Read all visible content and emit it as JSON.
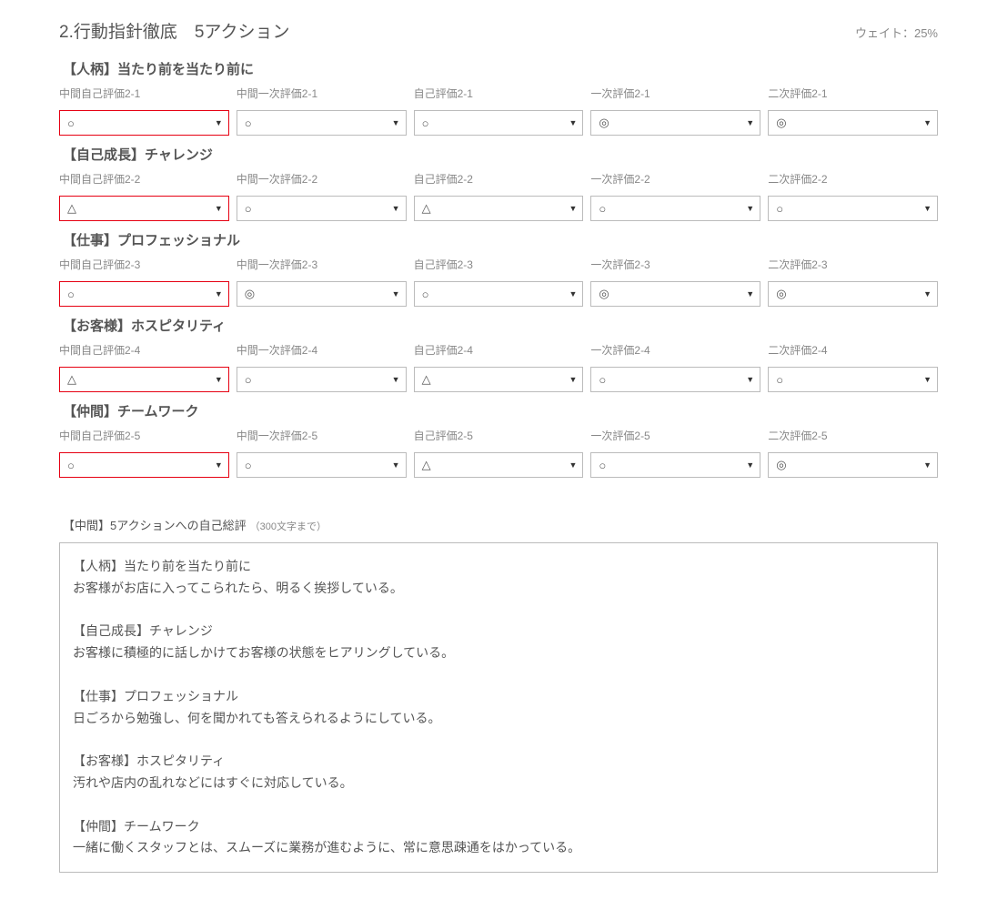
{
  "header": {
    "title": "2.行動指針徹底　5アクション",
    "weight": "ウェイト：25%"
  },
  "columns": [
    "中間自己評価",
    "中間一次評価",
    "自己評価",
    "一次評価",
    "二次評価"
  ],
  "sections": [
    {
      "title": "【人柄】当たり前を当たり前に",
      "id": "2-1",
      "values": [
        "○",
        "○",
        "○",
        "◎",
        "◎"
      ]
    },
    {
      "title": "【自己成長】チャレンジ",
      "id": "2-2",
      "values": [
        "△",
        "○",
        "△",
        "○",
        "○"
      ]
    },
    {
      "title": "【仕事】プロフェッショナル",
      "id": "2-3",
      "values": [
        "○",
        "◎",
        "○",
        "◎",
        "◎"
      ]
    },
    {
      "title": "【お客様】ホスピタリティ",
      "id": "2-4",
      "values": [
        "△",
        "○",
        "△",
        "○",
        "○"
      ]
    },
    {
      "title": "【仲間】チームワーク",
      "id": "2-5",
      "values": [
        "○",
        "○",
        "△",
        "○",
        "◎"
      ]
    }
  ],
  "comment": {
    "label": "【中間】5アクションへの自己総評",
    "sublabel": "（300文字まで）",
    "text": "【人柄】当たり前を当たり前に\nお客様がお店に入ってこられたら、明るく挨拶している。\n\n【自己成長】チャレンジ\nお客様に積極的に話しかけてお客様の状態をヒアリングしている。\n\n【仕事】プロフェッショナル\n日ごろから勉強し、何を聞かれても答えられるようにしている。\n\n【お客様】ホスピタリティ\n汚れや店内の乱れなどにはすぐに対応している。\n\n【仲間】チームワーク\n一緒に働くスタッフとは、スムーズに業務が進むように、常に意思疎通をはかっている。"
  }
}
